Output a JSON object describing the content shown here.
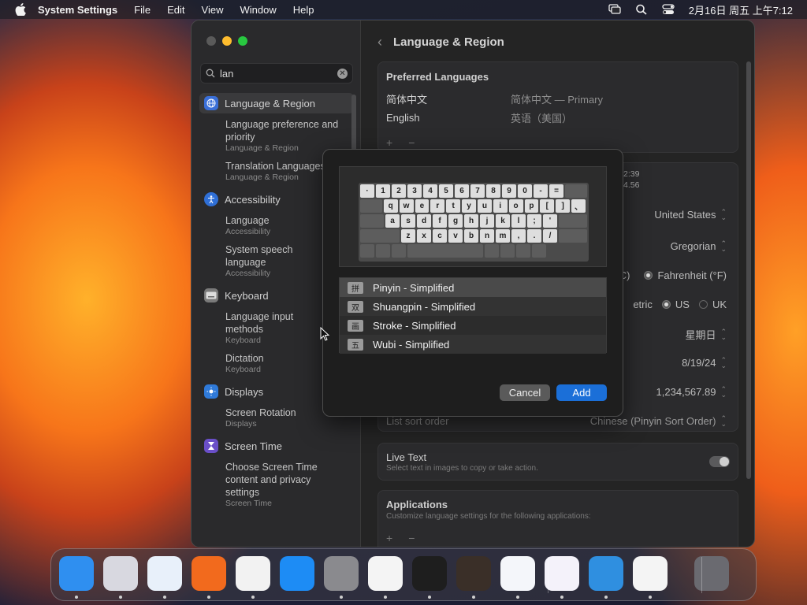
{
  "menubar": {
    "app": "System Settings",
    "items": [
      "File",
      "Edit",
      "View",
      "Window",
      "Help"
    ],
    "clock": "2月16日 周五  上午7:12",
    "icons": [
      "apple-icon",
      "screen-mirroring-icon",
      "search-icon",
      "control-center-icon"
    ]
  },
  "sidebar": {
    "search_value": "lan",
    "groups": [
      {
        "title": "Language & Region",
        "color": "#3a6fd8",
        "subs": [
          {
            "t": "Language preference and priority",
            "s": "Language & Region"
          },
          {
            "t": "Translation Languages",
            "s": "Language & Region"
          }
        ]
      },
      {
        "title": "Accessibility",
        "color": "#2f6fd6",
        "subs": [
          {
            "t": "Language",
            "s": "Accessibility"
          },
          {
            "t": "System speech language",
            "s": "Accessibility"
          }
        ]
      },
      {
        "title": "Keyboard",
        "color": "#7a7a7a",
        "subs": [
          {
            "t": "Language input methods",
            "s": "Keyboard"
          },
          {
            "t": "Dictation",
            "s": "Keyboard"
          }
        ]
      },
      {
        "title": "Displays",
        "color": "#2f7ad9",
        "subs": [
          {
            "t": "Screen Rotation",
            "s": "Displays"
          }
        ]
      },
      {
        "title": "Screen Time",
        "color": "#6a4fc8",
        "subs": [
          {
            "t": "Choose Screen Time content and privacy settings",
            "s": "Screen Time"
          }
        ]
      }
    ]
  },
  "main": {
    "title": "Language & Region",
    "preferred_header": "Preferred Languages",
    "languages": [
      {
        "name": "简体中文",
        "desc": "简体中文 — Primary"
      },
      {
        "name": "English",
        "desc": "英语（美国）"
      }
    ],
    "plus": "+",
    "minus": "−",
    "time_partial_1": "2:39",
    "time_partial_2": "4.56",
    "region": "United States",
    "calendar": "Gregorian",
    "temp_c_partial": "C)",
    "temp_f": "Fahrenheit (°F)",
    "measure_partial": "etric",
    "measure_us": "US",
    "measure_uk": "UK",
    "first_day": "星期日",
    "date_format": "8/19/24",
    "number_format": "1,234,567.89",
    "sort_label": "List sort order",
    "sort_value": "Chinese (Pinyin Sort Order)",
    "live_text_title": "Live Text",
    "live_text_desc": "Select text in images to copy or take action.",
    "apps_title": "Applications",
    "apps_desc": "Customize language settings for the following applications:"
  },
  "sheet": {
    "keyboard_rows": [
      [
        "·",
        "1",
        "2",
        "3",
        "4",
        "5",
        "6",
        "7",
        "8",
        "9",
        "0",
        "-",
        "="
      ],
      [
        "q",
        "w",
        "e",
        "r",
        "t",
        "y",
        "u",
        "i",
        "o",
        "p",
        "[",
        "]",
        "、"
      ],
      [
        "a",
        "s",
        "d",
        "f",
        "g",
        "h",
        "j",
        "k",
        "l",
        ";",
        "'"
      ],
      [
        "z",
        "x",
        "c",
        "v",
        "b",
        "n",
        "m",
        ",",
        ".",
        "/"
      ]
    ],
    "methods": [
      {
        "badge": "拼",
        "name": "Pinyin - Simplified"
      },
      {
        "badge": "双",
        "name": "Shuangpin - Simplified"
      },
      {
        "badge": "画",
        "name": "Stroke - Simplified"
      },
      {
        "badge": "五",
        "name": "Wubi - Simplified"
      }
    ],
    "cancel": "Cancel",
    "add": "Add"
  },
  "dock": {
    "apps": [
      {
        "name": "finder",
        "color": "#2f8ff0"
      },
      {
        "name": "launchpad",
        "color": "#d8d8e0"
      },
      {
        "name": "safari",
        "color": "#e8f0fa"
      },
      {
        "name": "firefox",
        "color": "#f26a1d"
      },
      {
        "name": "chrome",
        "color": "#f2f2f2"
      },
      {
        "name": "app-store",
        "color": "#1d8cf5"
      },
      {
        "name": "system-settings",
        "color": "#8a8a8e"
      },
      {
        "name": "textedit",
        "color": "#f4f4f4"
      },
      {
        "name": "terminal",
        "color": "#1e1e1e"
      },
      {
        "name": "garageband",
        "color": "#3a2f28"
      },
      {
        "name": "vscode",
        "color": "#f4f6fa"
      },
      {
        "name": "visual-studio",
        "color": "#f4f2fa"
      },
      {
        "name": "weather",
        "color": "#2f8fe0"
      },
      {
        "name": "instruments",
        "color": "#f4f4f4"
      },
      {
        "name": "trash",
        "color": "#6a6a70"
      }
    ]
  }
}
